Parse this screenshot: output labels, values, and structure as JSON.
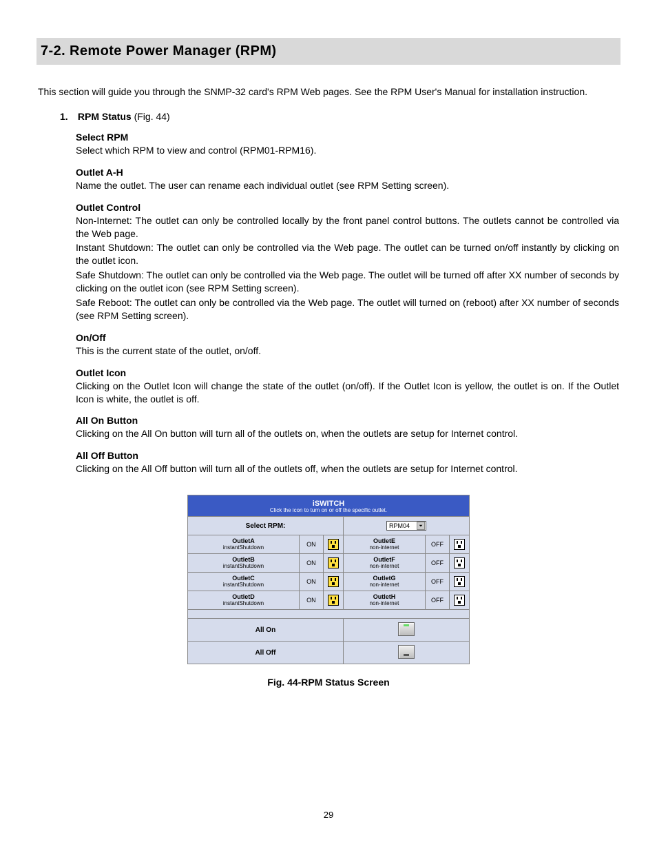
{
  "section": {
    "number": "7-2.",
    "title": "Remote Power Manager (RPM)"
  },
  "intro": "This section will guide you through the SNMP-32 card's RPM Web pages.  See the RPM User's Manual for installation instruction.",
  "list_item": {
    "no": "1.",
    "title": "RPM Status",
    "fig": " (Fig. 44)"
  },
  "blocks": {
    "select_rpm": {
      "h": "Select RPM",
      "p": "Select which RPM to view and control (RPM01-RPM16)."
    },
    "outlet_ah": {
      "h": "Outlet A-H",
      "p": "Name the outlet.  The user can rename each individual outlet (see RPM Setting screen)."
    },
    "outlet_control": {
      "h": "Outlet Control",
      "p1": "Non-Internet:  The outlet can only be controlled locally by the front panel control buttons.  The outlets cannot be controlled via the Web page.",
      "p2": "Instant Shutdown:  The outlet can only be controlled via the Web page.  The outlet can be turned on/off instantly by clicking on the outlet icon.",
      "p3": "Safe Shutdown:  The outlet can only be controlled via the Web page.  The outlet will be turned off after XX number of seconds by clicking on the outlet icon (see RPM Setting screen).",
      "p4": "Safe Reboot:  The outlet can only be controlled via the Web page.  The outlet will turned on (reboot) after XX number of seconds (see RPM Setting screen)."
    },
    "onoff": {
      "h": "On/Off",
      "p": "This is the current state of the outlet, on/off."
    },
    "outlet_icon": {
      "h": "Outlet Icon",
      "p": "Clicking on the Outlet Icon will change the state of the outlet (on/off).  If the Outlet Icon is yellow, the outlet is on.  If the Outlet Icon is white, the outlet is off."
    },
    "all_on": {
      "h": "All On Button",
      "p": "Clicking on the All On button will turn all of the outlets on, when the outlets are setup for Internet control."
    },
    "all_off": {
      "h": "All Off Button",
      "p": "Clicking on the All Off button will turn all of the outlets off, when the outlets are setup for Internet control."
    }
  },
  "figure": {
    "caption": "Fig. 44-RPM Status Screen",
    "title": "iSWITCH",
    "subtitle": "Click the icon to turn on or off the specific outlet.",
    "select_label": "Select RPM:",
    "select_value": "RPM04",
    "left": [
      {
        "name": "OutletA",
        "mode": "instantShutdown",
        "state": "ON"
      },
      {
        "name": "OutletB",
        "mode": "instantShutdown",
        "state": "ON"
      },
      {
        "name": "OutletC",
        "mode": "instantShutdown",
        "state": "ON"
      },
      {
        "name": "OutletD",
        "mode": "instantShutdown",
        "state": "ON"
      }
    ],
    "right": [
      {
        "name": "OutletE",
        "mode": "non-internet",
        "state": "OFF"
      },
      {
        "name": "OutletF",
        "mode": "non-internet",
        "state": "OFF"
      },
      {
        "name": "OutletG",
        "mode": "non-internet",
        "state": "OFF"
      },
      {
        "name": "OutletH",
        "mode": "non-internet",
        "state": "OFF"
      }
    ],
    "all_on_label": "All On",
    "all_off_label": "All Off"
  },
  "page_number": "29"
}
